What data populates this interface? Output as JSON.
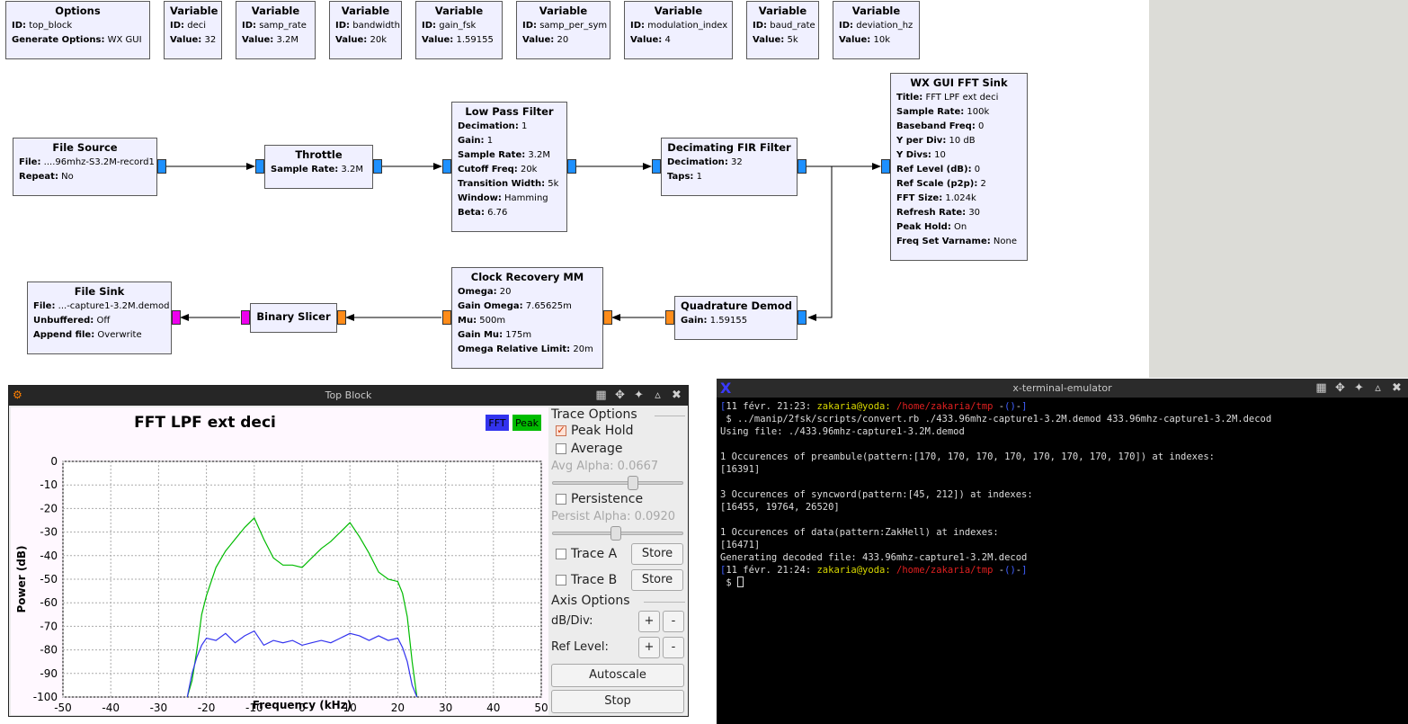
{
  "flowgraph": {
    "options": {
      "title": "Options",
      "params": [
        {
          "k": "ID",
          "v": "top_block"
        },
        {
          "k": "Generate Options",
          "v": "WX GUI"
        }
      ]
    },
    "variables": [
      {
        "title": "Variable",
        "id": "deci",
        "value": "32"
      },
      {
        "title": "Variable",
        "id": "samp_rate",
        "value": "3.2M"
      },
      {
        "title": "Variable",
        "id": "bandwidth",
        "value": "20k"
      },
      {
        "title": "Variable",
        "id": "gain_fsk",
        "value": "1.59155"
      },
      {
        "title": "Variable",
        "id": "samp_per_sym",
        "value": "20"
      },
      {
        "title": "Variable",
        "id": "modulation_index",
        "value": "4"
      },
      {
        "title": "Variable",
        "id": "baud_rate",
        "value": "5k"
      },
      {
        "title": "Variable",
        "id": "deviation_hz",
        "value": "10k"
      }
    ],
    "labels": {
      "id": "ID",
      "value": "Value"
    },
    "file_source": {
      "title": "File Source",
      "params": [
        {
          "k": "File",
          "v": "....96mhz-S3.2M-record1"
        },
        {
          "k": "Repeat",
          "v": "No"
        }
      ]
    },
    "throttle": {
      "title": "Throttle",
      "params": [
        {
          "k": "Sample Rate",
          "v": "3.2M"
        }
      ]
    },
    "low_pass": {
      "title": "Low Pass Filter",
      "params": [
        {
          "k": "Decimation",
          "v": "1"
        },
        {
          "k": "Gain",
          "v": "1"
        },
        {
          "k": "Sample Rate",
          "v": "3.2M"
        },
        {
          "k": "Cutoff Freq",
          "v": "20k"
        },
        {
          "k": "Transition Width",
          "v": "5k"
        },
        {
          "k": "Window",
          "v": "Hamming"
        },
        {
          "k": "Beta",
          "v": "6.76"
        }
      ]
    },
    "dec_fir": {
      "title": "Decimating FIR Filter",
      "params": [
        {
          "k": "Decimation",
          "v": "32"
        },
        {
          "k": "Taps",
          "v": "1"
        }
      ]
    },
    "fft_sink": {
      "title": "WX GUI FFT Sink",
      "params": [
        {
          "k": "Title",
          "v": "FFT LPF ext deci"
        },
        {
          "k": "Sample Rate",
          "v": "100k"
        },
        {
          "k": "Baseband Freq",
          "v": "0"
        },
        {
          "k": "Y per Div",
          "v": "10 dB"
        },
        {
          "k": "Y Divs",
          "v": "10"
        },
        {
          "k": "Ref Level (dB)",
          "v": "0"
        },
        {
          "k": "Ref Scale (p2p)",
          "v": "2"
        },
        {
          "k": "FFT Size",
          "v": "1.024k"
        },
        {
          "k": "Refresh Rate",
          "v": "30"
        },
        {
          "k": "Peak Hold",
          "v": "On"
        },
        {
          "k": "Freq Set Varname",
          "v": "None"
        }
      ]
    },
    "file_sink": {
      "title": "File Sink",
      "params": [
        {
          "k": "File",
          "v": "...-capture1-3.2M.demod"
        },
        {
          "k": "Unbuffered",
          "v": "Off"
        },
        {
          "k": "Append file",
          "v": "Overwrite"
        }
      ]
    },
    "slicer": {
      "title": "Binary Slicer"
    },
    "clock_rec": {
      "title": "Clock Recovery MM",
      "params": [
        {
          "k": "Omega",
          "v": "20"
        },
        {
          "k": "Gain Omega",
          "v": "7.65625m"
        },
        {
          "k": "Mu",
          "v": "500m"
        },
        {
          "k": "Gain Mu",
          "v": "175m"
        },
        {
          "k": "Omega Relative Limit",
          "v": "20m"
        }
      ]
    },
    "quad": {
      "title": "Quadrature Demod",
      "params": [
        {
          "k": "Gain",
          "v": "1.59155"
        }
      ]
    }
  },
  "fft_window": {
    "title": "Top Block",
    "legend_fft": "FFT",
    "legend_peak": "Peak",
    "trace_options": "Trace Options",
    "peak_hold": "Peak Hold",
    "average": "Average",
    "avg_alpha": "Avg Alpha: 0.0667",
    "persistence": "Persistence",
    "persist_alpha": "Persist Alpha: 0.0920",
    "trace_a": "Trace A",
    "trace_b": "Trace B",
    "store": "Store",
    "axis_options": "Axis Options",
    "db_div": "dB/Div:",
    "ref_level": "Ref Level:",
    "plus": "+",
    "minus": "-",
    "autoscale": "Autoscale",
    "stop": "Stop",
    "peak_hold_checked": true,
    "average_checked": false,
    "persistence_checked": false,
    "avg_alpha_value": 0.0667,
    "persist_alpha_value": 0.092
  },
  "chart_data": {
    "type": "line",
    "title": "FFT LPF ext deci",
    "xlabel": "Frequency (kHz)",
    "ylabel": "Power (dB)",
    "xlim": [
      -50,
      50
    ],
    "ylim": [
      -100,
      0
    ],
    "xticks": [
      -50,
      -40,
      -30,
      -20,
      -10,
      0,
      10,
      20,
      30,
      40,
      50
    ],
    "yticks": [
      0,
      -10,
      -20,
      -30,
      -40,
      -50,
      -60,
      -70,
      -80,
      -90,
      -100
    ],
    "grid": true,
    "legend": "top-right",
    "series": [
      {
        "name": "FFT",
        "color": "#3333ee",
        "x": [
          -24,
          -23,
          -22,
          -21,
          -20,
          -18,
          -16,
          -14,
          -12,
          -10,
          -8,
          -6,
          -4,
          -2,
          0,
          2,
          4,
          6,
          8,
          10,
          12,
          14,
          16,
          18,
          20,
          21,
          22,
          23,
          24
        ],
        "y": [
          -100,
          -90,
          -83,
          -78,
          -75,
          -76,
          -73,
          -77,
          -74,
          -72,
          -78,
          -76,
          -77,
          -76,
          -78,
          -77,
          -76,
          -77,
          -75,
          -73,
          -74,
          -76,
          -74,
          -76,
          -75,
          -79,
          -85,
          -95,
          -100
        ]
      },
      {
        "name": "Peak",
        "color": "#00bb00",
        "x": [
          -24,
          -23,
          -22,
          -21,
          -20,
          -18,
          -16,
          -14,
          -12,
          -10,
          -8,
          -6,
          -4,
          -2,
          0,
          2,
          4,
          6,
          8,
          10,
          12,
          14,
          16,
          18,
          20,
          21,
          22,
          23,
          24
        ],
        "y": [
          -100,
          -93,
          -80,
          -65,
          -57,
          -45,
          -38,
          -33,
          -28,
          -24,
          -33,
          -41,
          -44,
          -44,
          -45,
          -41,
          -37,
          -34,
          -30,
          -26,
          -32,
          -39,
          -47,
          -50,
          -51,
          -56,
          -66,
          -85,
          -100
        ]
      }
    ]
  },
  "terminal": {
    "title": "x-terminal-emulator",
    "lines": [
      [
        {
          "t": "[",
          "c": "t-blue"
        },
        {
          "t": "11 févr. 21:23: ",
          "c": ""
        },
        {
          "t": "zakaria@yoda: ",
          "c": "t-yel"
        },
        {
          "t": "/home/zakaria/tmp",
          "c": "t-red"
        },
        {
          "t": " -",
          "c": ""
        },
        {
          "t": "(",
          "c": "t-blue"
        },
        {
          "t": ")",
          "c": "t-blue"
        },
        {
          "t": "-",
          "c": ""
        },
        {
          "t": "]",
          "c": "t-blue"
        }
      ],
      [
        {
          "t": " $ ../manip/2fsk/scripts/convert.rb ./433.96mhz-capture1-3.2M.demod 433.96mhz-capture1-3.2M.decod",
          "c": ""
        }
      ],
      [
        {
          "t": "Using file: ./433.96mhz-capture1-3.2M.demod",
          "c": ""
        }
      ],
      [
        {
          "t": "",
          "c": ""
        }
      ],
      [
        {
          "t": "1 Occurences of preambule(pattern:[170, 170, 170, 170, 170, 170, 170, 170]) at indexes:",
          "c": ""
        }
      ],
      [
        {
          "t": "[16391]",
          "c": ""
        }
      ],
      [
        {
          "t": "",
          "c": ""
        }
      ],
      [
        {
          "t": "3 Occurences of syncword(pattern:[45, 212]) at indexes:",
          "c": ""
        }
      ],
      [
        {
          "t": "[16455, 19764, 26520]",
          "c": ""
        }
      ],
      [
        {
          "t": "",
          "c": ""
        }
      ],
      [
        {
          "t": "1 Occurences of data(pattern:ZakHell) at indexes:",
          "c": ""
        }
      ],
      [
        {
          "t": "[16471]",
          "c": ""
        }
      ],
      [
        {
          "t": "Generating decoded file: 433.96mhz-capture1-3.2M.decod",
          "c": ""
        }
      ],
      [
        {
          "t": "[",
          "c": "t-blue"
        },
        {
          "t": "11 févr. 21:24: ",
          "c": ""
        },
        {
          "t": "zakaria@yoda: ",
          "c": "t-yel"
        },
        {
          "t": "/home/zakaria/tmp",
          "c": "t-red"
        },
        {
          "t": " -",
          "c": ""
        },
        {
          "t": "(",
          "c": "t-blue"
        },
        {
          "t": ")",
          "c": "t-blue"
        },
        {
          "t": "-",
          "c": ""
        },
        {
          "t": "]",
          "c": "t-blue"
        }
      ],
      [
        {
          "t": " $ ",
          "c": ""
        }
      ]
    ]
  }
}
